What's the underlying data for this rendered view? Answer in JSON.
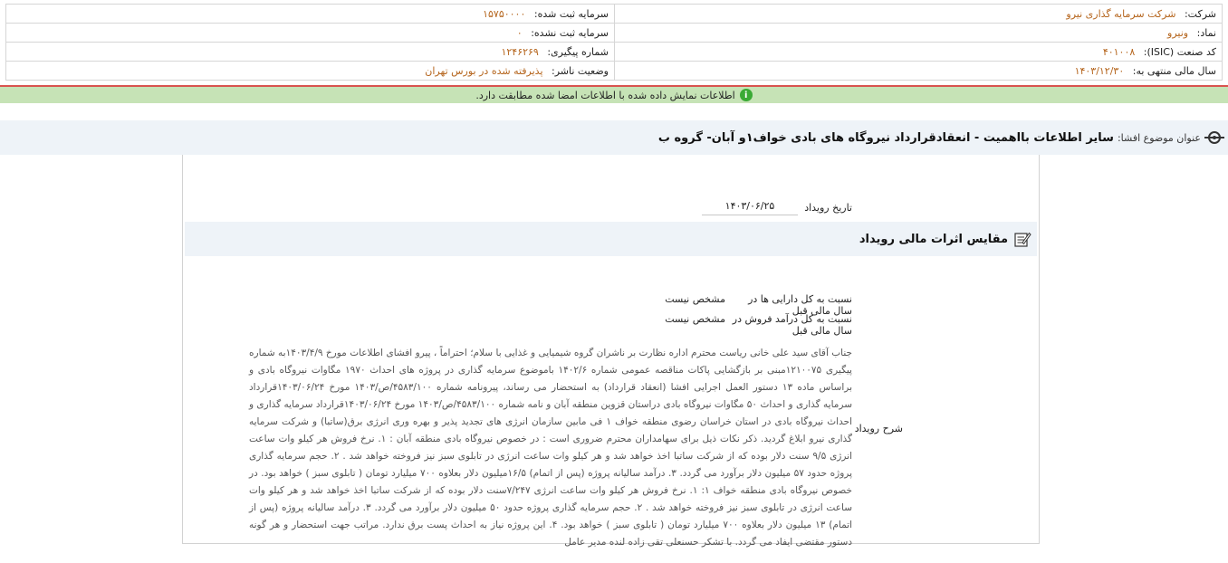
{
  "company_info": {
    "company_label": "شرکت:",
    "company_value": "شرکت سرمایه گذاری نیرو",
    "registered_capital_label": "سرمایه ثبت شده:",
    "registered_capital_value": "۱۵۷۵۰۰۰۰",
    "symbol_label": "نماد:",
    "symbol_value": "ونیرو",
    "unregistered_capital_label": "سرمایه ثبت نشده:",
    "unregistered_capital_value": "۰",
    "isic_label": "کد صنعت (ISIC):",
    "isic_value": "۴۰۱۰۰۸",
    "tracking_label": "شماره پیگیری:",
    "tracking_value": "۱۲۴۶۲۶۹",
    "fiscal_year_label": "سال مالی منتهی به:",
    "fiscal_year_value": "۱۴۰۳/۱۲/۳۰",
    "publisher_status_label": "وضعیت ناشر:",
    "publisher_status_value": "پذیرفته شده در بورس تهران"
  },
  "status": {
    "message": "اطلاعات نمایش داده شده با اطلاعات امضا شده مطابقت دارد.",
    "color": "#c6e3b6",
    "icon": "info-icon"
  },
  "subject": {
    "label": "عنوان موضوع افشا:",
    "title": "سایر اطلاعات بااهمیت - انعقادقرارداد نیروگاه های بادی خواف۱و آبان- گروه ب"
  },
  "event": {
    "date_label": "تاریخ رویداد",
    "date_value": "۱۴۰۳/۰۶/۲۵"
  },
  "financial_impact": {
    "title": "مقایس اثرات مالی رویداد",
    "assets_ratio_label": "نسبت به کل دارایی ها در سال مالی قبل",
    "assets_ratio_value": "مشخص نیست",
    "revenue_ratio_label": "نسبت به کل درآمد فروش در سال مالی قبل",
    "revenue_ratio_value": "مشخص نیست"
  },
  "description": {
    "label": "شرح رویداد",
    "text": "جناب آقای سید علی خانی ریاست محترم اداره نظارت بر ناشران گروه شیمیایی و غذایی با سلام؛ احتراماً ، پیرو افشای اطلاعات مورخ ۱۴۰۳/۴/۹به شماره پیگیری ۱۲۱۰۰۷۵مبنی بر بازگشایی پاکات مناقصه عمومی شماره ۱۴۰۲/۶ باموضوع سرمایه گذاری در پروژه های احداث ۱۹۷۰ مگاوات نیروگاه بادی و براساس ماده ۱۳ دستور العمل اجرایی افشا (انعقاد قرارداد) به استحضار می رساند، پیرونامه شماره ۴۵۸۳/۱۰۰/ص/۱۴۰۳ مورخ ۱۴۰۳/۰۶/۲۴قرارداد سرمایه گذاری و احداث ۵۰ مگاوات نیروگاه بادی دراستان قزوین منطقه آبان و نامه شماره ۴۵۸۳/۱۰۰/ص/۱۴۰۳ مورخ ۱۴۰۳/۰۶/۲۴قرارداد سرمایه گذاری و احداث نیروگاه بادی در استان خراسان رضوی منطقه خواف ۱ فی مابین سازمان انرژی های تجدید پذیر و بهره وری انرژی برق(ساتبا) و شرکت سرمایه گذاری نیرو ابلاغ گردید. ذکر نکات ذیل برای سهامداران محترم ضروری است : در خصوص نیروگاه بادی منطقه آبان : ۱. نرخ فروش هر کیلو وات ساعت انرژی ۹/۵ سنت دلار بوده که از شرکت ساتبا اخذ خواهد شد و هر کیلو وات ساعت انرژی در تابلوی سبز نیز فروخته خواهد شد . ۲. حجم سرمایه گذاری پروژه حدود ۵۷ میلیون دلار برآورد می گردد. ۳. درآمد سالیانه پروژه (پس از اتمام) ۱۶/۵میلیون دلار بعلاوه ۷۰۰ میلیارد تومان ( تابلوی سبز ) خواهد بود. در خصوص نیروگاه بادی منطقه خواف ۱: ۱. نرخ فروش هر کیلو وات ساعت انرژی ۷/۲۴۷سنت دلار بوده که از شرکت ساتبا اخذ خواهد شد و هر کیلو وات ساعت انرژی در تابلوی سبز نیز فروخته خواهد شد . ۲. حجم سرمایه گذاری پروژه حدود ۵۰ میلیون دلار برآورد می گردد. ۳. درآمد سالیانه پروژه (پس از اتمام) ۱۳ میلیون دلار بعلاوه ۷۰۰ میلیارد تومان ( تابلوی سبز ) خواهد بود. ۴. این پروژه نیاز به احداث پست برق ندارد. مراتب جهت استحضار و هر گونه دستور مقتضی ایفاد می گردد. با تشکر حسنعلی تقی زاده لنده مدیر عامل"
  }
}
